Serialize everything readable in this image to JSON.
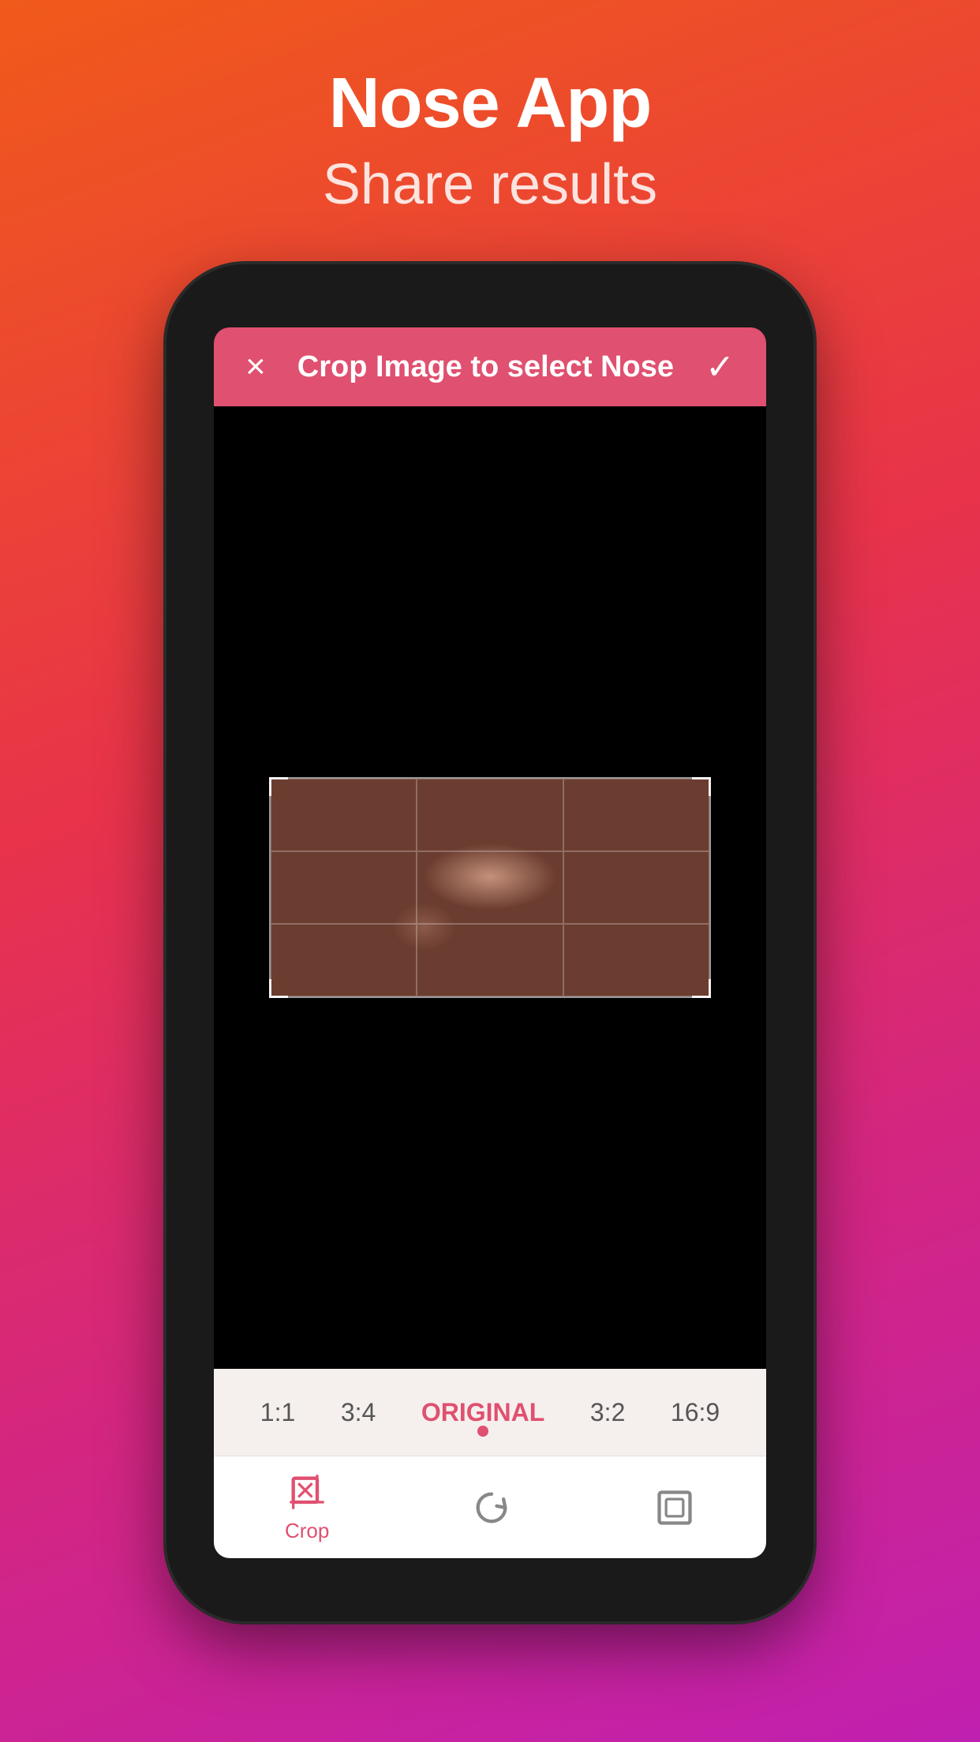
{
  "header": {
    "app_title": "Nose App",
    "app_subtitle": "Share results"
  },
  "crop_bar": {
    "title": "Crop Image to select Nose",
    "close_label": "×",
    "confirm_label": "✓"
  },
  "ratio_options": [
    {
      "label": "1:1",
      "active": false
    },
    {
      "label": "3:4",
      "active": false
    },
    {
      "label": "ORIGINAL",
      "active": true
    },
    {
      "label": "3:2",
      "active": false
    },
    {
      "label": "16:9",
      "active": false
    }
  ],
  "toolbar": {
    "crop_label": "Crop",
    "items": [
      {
        "id": "crop",
        "label": "Crop",
        "active": true
      },
      {
        "id": "rotate",
        "label": "",
        "active": false
      },
      {
        "id": "expand",
        "label": "",
        "active": false
      }
    ]
  },
  "colors": {
    "accent": "#e05070",
    "background_gradient_start": "#f05a1a",
    "background_gradient_end": "#c020b0"
  }
}
